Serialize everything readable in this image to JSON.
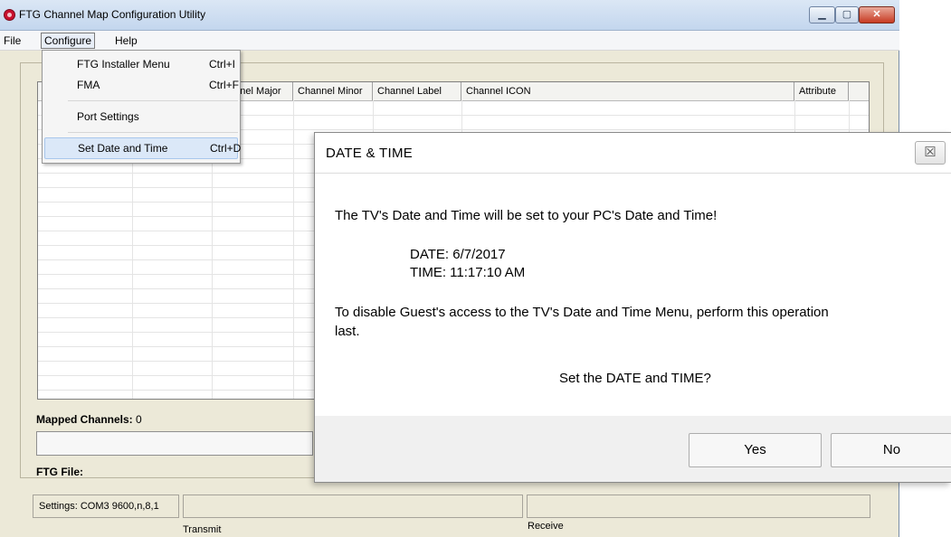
{
  "window": {
    "title": "FTG Channel Map Configuration Utility",
    "min_glyph": "▁",
    "max_glyph": "▢",
    "close_glyph": "✕"
  },
  "menu": {
    "file": "File",
    "configure": "Configure",
    "help": "Help"
  },
  "configure_menu": {
    "items": [
      {
        "label": "FTG Installer Menu",
        "shortcut": "Ctrl+I"
      },
      {
        "label": "FMA",
        "shortcut": "Ctrl+F"
      },
      {
        "label": "Port Settings",
        "shortcut": ""
      },
      {
        "label": "Set Date and Time",
        "shortcut": "Ctrl+D"
      }
    ]
  },
  "grid": {
    "columns": [
      "",
      "",
      "Channel Major",
      "Channel Minor",
      "Channel Label",
      "Channel ICON",
      "Attribute"
    ]
  },
  "mapped_channels": {
    "label": "Mapped Channels:",
    "value": "0"
  },
  "ftg_file": {
    "label": "FTG File:"
  },
  "status": {
    "settings": "Settings: COM3 9600,n,8,1",
    "transmit_label": "Transmit",
    "receive_label": "Receive"
  },
  "dialog": {
    "title": "DATE & TIME",
    "close_glyph": "☒",
    "message": "The TV's Date and Time will be set to your PC's Date and Time!",
    "date_line": "DATE:  6/7/2017",
    "time_line": "TIME:  11:17:10 AM",
    "disable_line_1": "To disable Guest's access to the TV's Date and Time Menu, perform this operation",
    "disable_line_2": "last.",
    "question": "Set the DATE and TIME?",
    "yes": "Yes",
    "no": "No"
  },
  "colors": {
    "accent": "#c8102e",
    "menu_highlight": "#dbe8f8"
  }
}
